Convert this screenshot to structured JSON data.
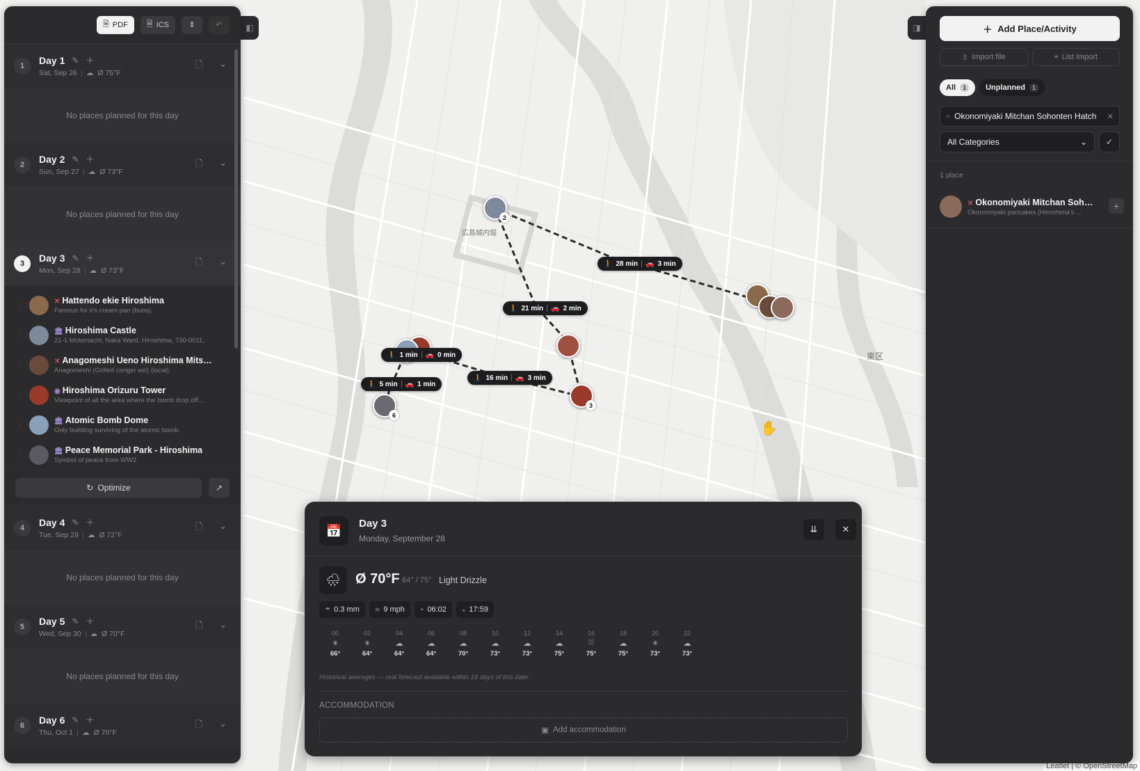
{
  "toolbar": {
    "pdf": "PDF",
    "ics": "ICS"
  },
  "days": [
    {
      "num": "1",
      "title": "Day 1",
      "date": "Sat, Sep 26",
      "weather": "Ø 75°F",
      "empty": "No places planned for this day"
    },
    {
      "num": "2",
      "title": "Day 2",
      "date": "Sun, Sep 27",
      "weather": "Ø 73°F",
      "empty": "No places planned for this day"
    },
    {
      "num": "3",
      "title": "Day 3",
      "date": "Mon, Sep 28",
      "weather": "Ø 73°F"
    },
    {
      "num": "4",
      "title": "Day 4",
      "date": "Tue, Sep 29",
      "weather": "Ø 72°F",
      "empty": "No places planned for this day"
    },
    {
      "num": "5",
      "title": "Day 5",
      "date": "Wed, Sep 30",
      "weather": "Ø 70°F",
      "empty": "No places planned for this day"
    },
    {
      "num": "6",
      "title": "Day 6",
      "date": "Thu, Oct 1",
      "weather": "Ø 70°F"
    }
  ],
  "day3_places": [
    {
      "name": "Hattendo ekie Hiroshima",
      "desc": "Famous for it's cream pan (buns).",
      "cat": "food",
      "color": "#8a6a4a"
    },
    {
      "name": "Hiroshima Castle",
      "desc": "21-1 Motomachi, Naka Ward, Hiroshima, 730-0011,",
      "cat": "monument",
      "color": "#7d8a9c"
    },
    {
      "name": "Anagomeshi Ueno Hiroshima Mitsu...",
      "desc": "Anagomeshi (Grilled conger eel) (local).",
      "cat": "food",
      "color": "#6a4a3a"
    },
    {
      "name": "Hiroshima Orizuru Tower",
      "desc": "Viewpoint of all the area where the bomb drop off...",
      "cat": "monument",
      "color": "#9a3a2a"
    },
    {
      "name": "Atomic Bomb Dome",
      "desc": "Only building surviving of the atomic bomb.",
      "cat": "monument",
      "color": "#8aa0b8"
    },
    {
      "name": "Peace Memorial Park - Hiroshima",
      "desc": "Symbol of peace from WW2",
      "cat": "monument",
      "color": "#5a5a60"
    }
  ],
  "optimize_label": "Optimize",
  "right": {
    "add_label": "Add Place/Activity",
    "import_file": "Import file",
    "list_import": "List Import",
    "filter_all": "All",
    "filter_all_count": "1",
    "filter_unplanned": "Unplanned",
    "filter_unplanned_count": "1",
    "search_value": "Okonomiyaki Mitchan Sohonten Hatch",
    "category": "All Categories",
    "count_label": "1 place",
    "place": {
      "name": "Okonomiyaki Mitchan Soho...",
      "desc": "Okonomiyaki pancakes (Hiroshima's ...",
      "color": "#8a6a5a"
    }
  },
  "map": {
    "badges": [
      {
        "walk": "28 min",
        "drive": "3 min"
      },
      {
        "walk": "21 min",
        "drive": "2 min"
      },
      {
        "walk": "1 min",
        "drive": "0 min"
      },
      {
        "walk": "5 min",
        "drive": "1 min"
      },
      {
        "walk": "16 min",
        "drive": "3 min"
      }
    ],
    "pins": [
      {
        "num": "2",
        "color": "#7d8a9c"
      },
      {
        "num": "3",
        "color": "#9a3a2a"
      },
      {
        "num": "6",
        "color": "#6a6a70"
      }
    ],
    "district": "東区",
    "place_label": "広島城内堀",
    "attribution": "Leaflet | © OpenStreetMap"
  },
  "panel": {
    "title": "Day 3",
    "subtitle": "Monday, September 28",
    "temp": "Ø 70°F",
    "range": "64° / 75°",
    "desc": "Light Drizzle",
    "precip": "0.3 mm",
    "wind": "9 mph",
    "sunrise": "06:02",
    "sunset": "17:59",
    "hours": [
      {
        "h": "00",
        "t": "66°",
        "icon": "sun"
      },
      {
        "h": "02",
        "t": "64°",
        "icon": "sun"
      },
      {
        "h": "04",
        "t": "64°",
        "icon": "cloud"
      },
      {
        "h": "06",
        "t": "64°",
        "icon": "cloud"
      },
      {
        "h": "08",
        "t": "70°",
        "icon": "cloud"
      },
      {
        "h": "10",
        "t": "73°",
        "icon": "cloud"
      },
      {
        "h": "12",
        "t": "73°",
        "icon": "cloud"
      },
      {
        "h": "14",
        "t": "75°",
        "icon": "cloud"
      },
      {
        "h": "16",
        "t": "75°",
        "icon": "rain"
      },
      {
        "h": "18",
        "t": "75°",
        "icon": "cloud"
      },
      {
        "h": "20",
        "t": "73°",
        "icon": "sun"
      },
      {
        "h": "22",
        "t": "73°",
        "icon": "cloud"
      }
    ],
    "hist_note": "Historical averages — real forecast available within 16 days of this date.",
    "acc_label": "ACCOMMODATION",
    "acc_add": "Add accommodation"
  }
}
